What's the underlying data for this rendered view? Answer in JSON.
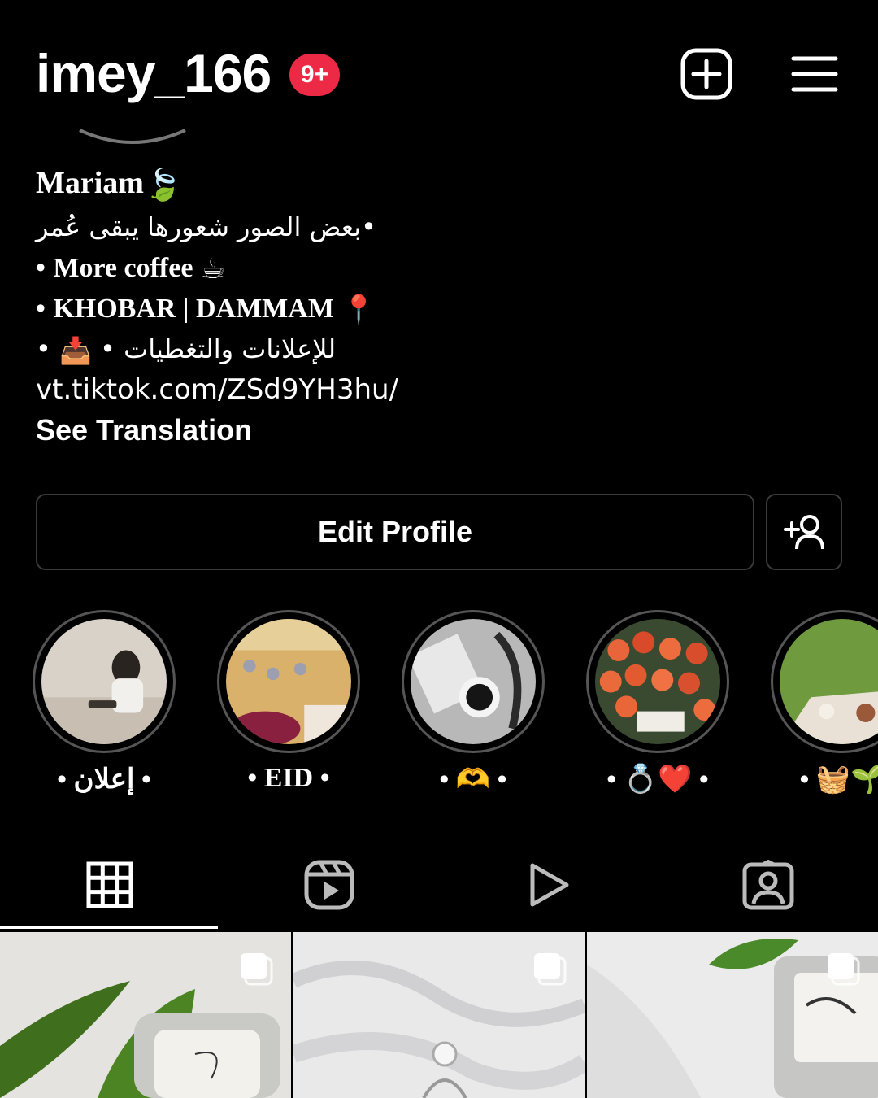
{
  "header": {
    "username": "imey_166",
    "notification_badge": "9+",
    "badge_color": "#ed2a45",
    "icons": [
      "plus-square-icon",
      "hamburger-menu-icon"
    ]
  },
  "bio": {
    "name": "Mariam",
    "name_emoji": "🍃",
    "line1": "بعض الصور شعورها يبقى عُمر•",
    "line2_bullet": "•",
    "line2_text": "More coffee",
    "line2_emoji": "☕",
    "line3_bullet": "•",
    "line3_text": "KHOBAR | DAMMAM",
    "line3_emoji": "📍",
    "line4_text": "• للإعلانات والتغطيات",
    "line4_emoji": "📥",
    "line4_end": "•",
    "link": "vt.tiktok.com/ZSd9YH3hu/",
    "see_translation": "See Translation"
  },
  "actions": {
    "edit_profile": "Edit Profile",
    "discover_people_icon": "add-person-icon"
  },
  "highlights": [
    {
      "label": "• إعلان •"
    },
    {
      "label": "• EID •"
    },
    {
      "label": "• 🫶 •"
    },
    {
      "label": "• 💍❤️ •"
    },
    {
      "label": "• 🧺🌱"
    }
  ],
  "tabs": [
    {
      "name": "grid",
      "icon": "grid-icon",
      "selected": true
    },
    {
      "name": "reels",
      "icon": "reels-icon",
      "selected": false
    },
    {
      "name": "videos",
      "icon": "play-icon",
      "selected": false
    },
    {
      "name": "tagged",
      "icon": "tagged-person-icon",
      "selected": false
    }
  ],
  "posts": [
    {
      "type": "carousel"
    },
    {
      "type": "carousel"
    },
    {
      "type": "carousel"
    }
  ]
}
